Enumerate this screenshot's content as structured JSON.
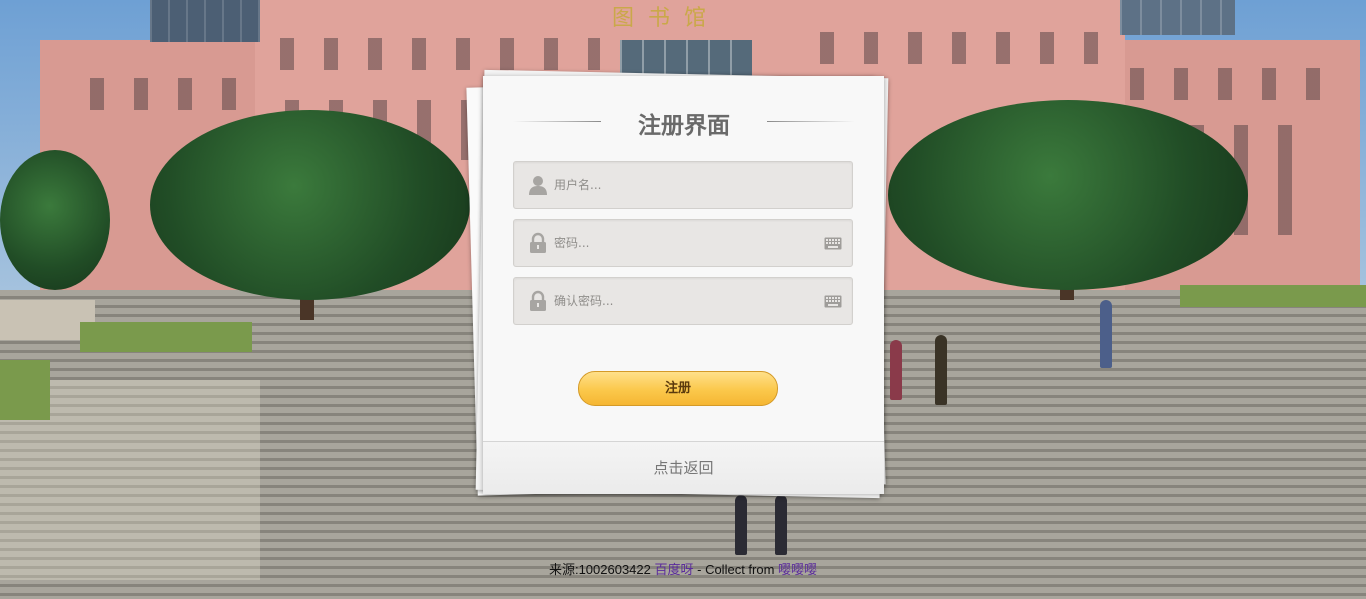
{
  "form": {
    "title": "注册界面",
    "username_placeholder": "用户名...",
    "password_placeholder": "密码...",
    "confirm_placeholder": "确认密码...",
    "submit_label": "注册",
    "back_label": "点击返回"
  },
  "credit": {
    "prefix": "来源:1002603422",
    "link1": "百度呀",
    "middle": " - Collect from ",
    "link2": "嘤嘤嘤"
  },
  "background": {
    "building_sign": "图书馆"
  },
  "colors": {
    "button_top": "#ffe08a",
    "button_bottom": "#f5b633",
    "title": "#6a6a6a",
    "link": "#5b2c9c"
  },
  "icons": {
    "username": "user-icon",
    "password": "lock-icon",
    "confirm": "lock-icon",
    "keyboard": "keyboard-icon"
  }
}
